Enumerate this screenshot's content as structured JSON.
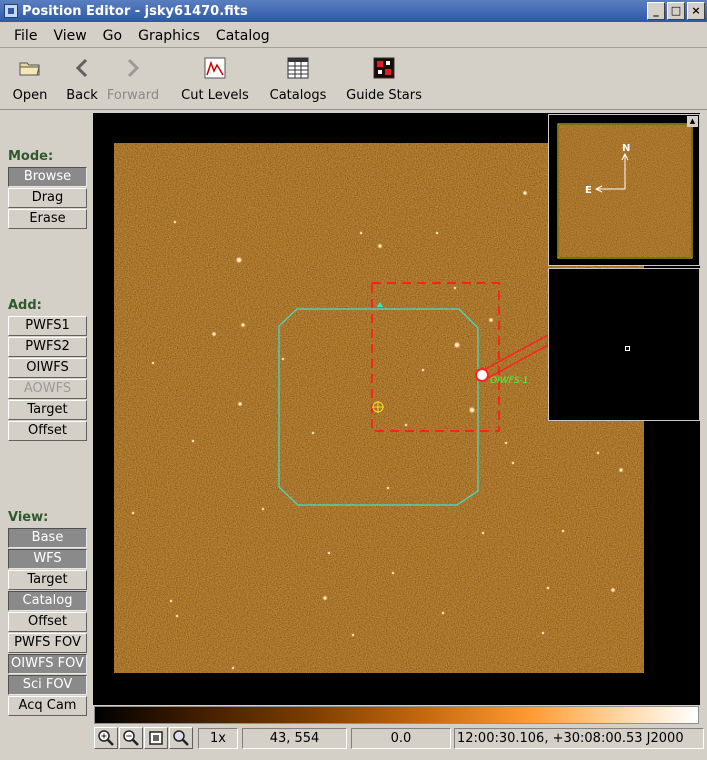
{
  "window": {
    "title": "Position Editor - jsky61470.fits",
    "controls": [
      "_",
      "□",
      "×"
    ]
  },
  "menu": [
    "File",
    "View",
    "Go",
    "Graphics",
    "Catalog"
  ],
  "toolbar": {
    "open": "Open",
    "back": "Back",
    "forward": "Forward",
    "cut_levels": "Cut Levels",
    "catalogs": "Catalogs",
    "guide_stars": "Guide Stars"
  },
  "mode": {
    "label": "Mode:",
    "buttons": [
      {
        "label": "Browse",
        "state": "pressed"
      },
      {
        "label": "Drag",
        "state": "normal"
      },
      {
        "label": "Erase",
        "state": "normal"
      }
    ]
  },
  "add": {
    "label": "Add:",
    "buttons": [
      {
        "label": "PWFS1",
        "state": "normal"
      },
      {
        "label": "PWFS2",
        "state": "normal"
      },
      {
        "label": "OIWFS",
        "state": "normal"
      },
      {
        "label": "AOWFS",
        "state": "disabled"
      },
      {
        "label": "Target",
        "state": "normal"
      },
      {
        "label": "Offset",
        "state": "normal"
      }
    ]
  },
  "view": {
    "label": "View:",
    "buttons": [
      {
        "label": "Base",
        "state": "pressed"
      },
      {
        "label": "WFS",
        "state": "pressed"
      },
      {
        "label": "Target",
        "state": "normal"
      },
      {
        "label": "Catalog",
        "state": "pressed"
      },
      {
        "label": "Offset",
        "state": "normal"
      },
      {
        "label": "PWFS FOV",
        "state": "normal"
      },
      {
        "label": "OIWFS FOV",
        "state": "pressed"
      },
      {
        "label": "Sci FOV",
        "state": "pressed"
      },
      {
        "label": "Acq Cam",
        "state": "normal"
      }
    ]
  },
  "image": {
    "wfs_label": "OIWFS-1",
    "compass_north": "N",
    "compass_east": "E"
  },
  "status": {
    "zoom_level": "1x",
    "pixel": "43, 554",
    "value": "0.0",
    "coords": "12:00:30.106, +30:08:00.53 J2000"
  },
  "colors": {
    "title_bar": "#2e57a8",
    "section_label": "#2e5a2e",
    "sci_fov": "#40e0d0",
    "oiwfs_fov": "#ff2020",
    "wfs_label": "#40ff40"
  }
}
